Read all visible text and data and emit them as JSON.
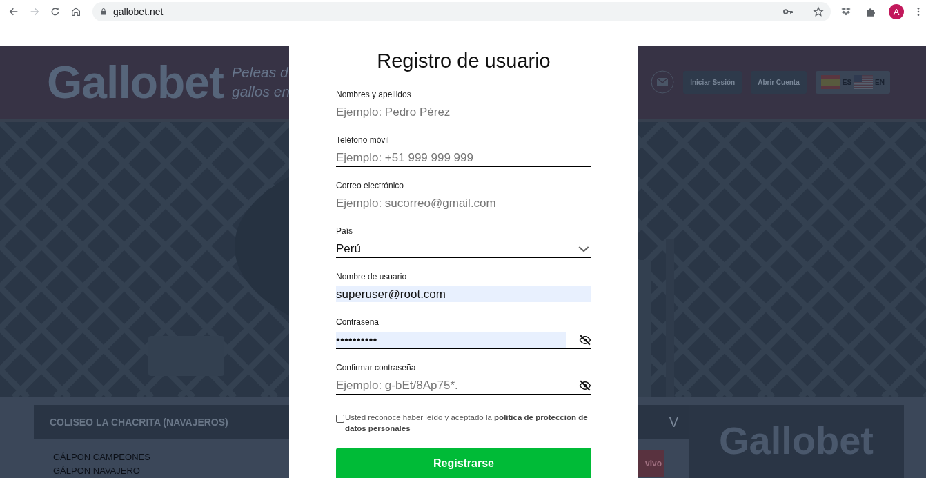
{
  "browser": {
    "url": "gallobet.net",
    "profile_initial": "A"
  },
  "site_header": {
    "logo": "Gallobet",
    "tagline_lines": [
      "Peleas d",
      "gallos en"
    ],
    "buttons": [
      "Iniciar Sesión",
      "Abrir Cuenta"
    ],
    "languages": [
      {
        "code": "ES",
        "kind": "es"
      },
      {
        "code": "EN",
        "kind": "us"
      }
    ]
  },
  "events": {
    "venue": "COLISEO LA CHACRITA (NAVAJEROS)",
    "toggle": "V",
    "items": [
      "GÁLPON CAMPEONES",
      "GÁLPON NAVAJERO"
    ],
    "live_button": "vivo",
    "card_logo": "Gallobet"
  },
  "modal": {
    "title": "Registro de usuario",
    "fields": [
      {
        "kind": "text",
        "label": "Nombres y apellidos",
        "placeholder": "Ejemplo: Pedro Pérez",
        "autofilled": false
      },
      {
        "kind": "text",
        "label": "Teléfono móvil",
        "placeholder": "Ejemplo: +51 999 999 999",
        "autofilled": false
      },
      {
        "kind": "text",
        "label": "Correo electrónico",
        "placeholder": "Ejemplo: sucorreo@gmail.com",
        "autofilled": false
      },
      {
        "kind": "select",
        "label": "País",
        "value": "Perú"
      },
      {
        "kind": "text",
        "label": "Nombre de usuario",
        "value": "superuser@root.com",
        "autofilled": true
      },
      {
        "kind": "password",
        "label": "Contraseña",
        "value": "••••••••••",
        "autofilled": true
      },
      {
        "kind": "password",
        "label": "Confirmar contraseña",
        "placeholder": "Ejemplo: g-bEt/8Ap75*.",
        "autofilled": false
      }
    ],
    "consent": {
      "text": "Usted reconoce haber leído y aceptado la **política de protección de datos personales**",
      "checked": false
    },
    "submit": "Registrarse"
  }
}
